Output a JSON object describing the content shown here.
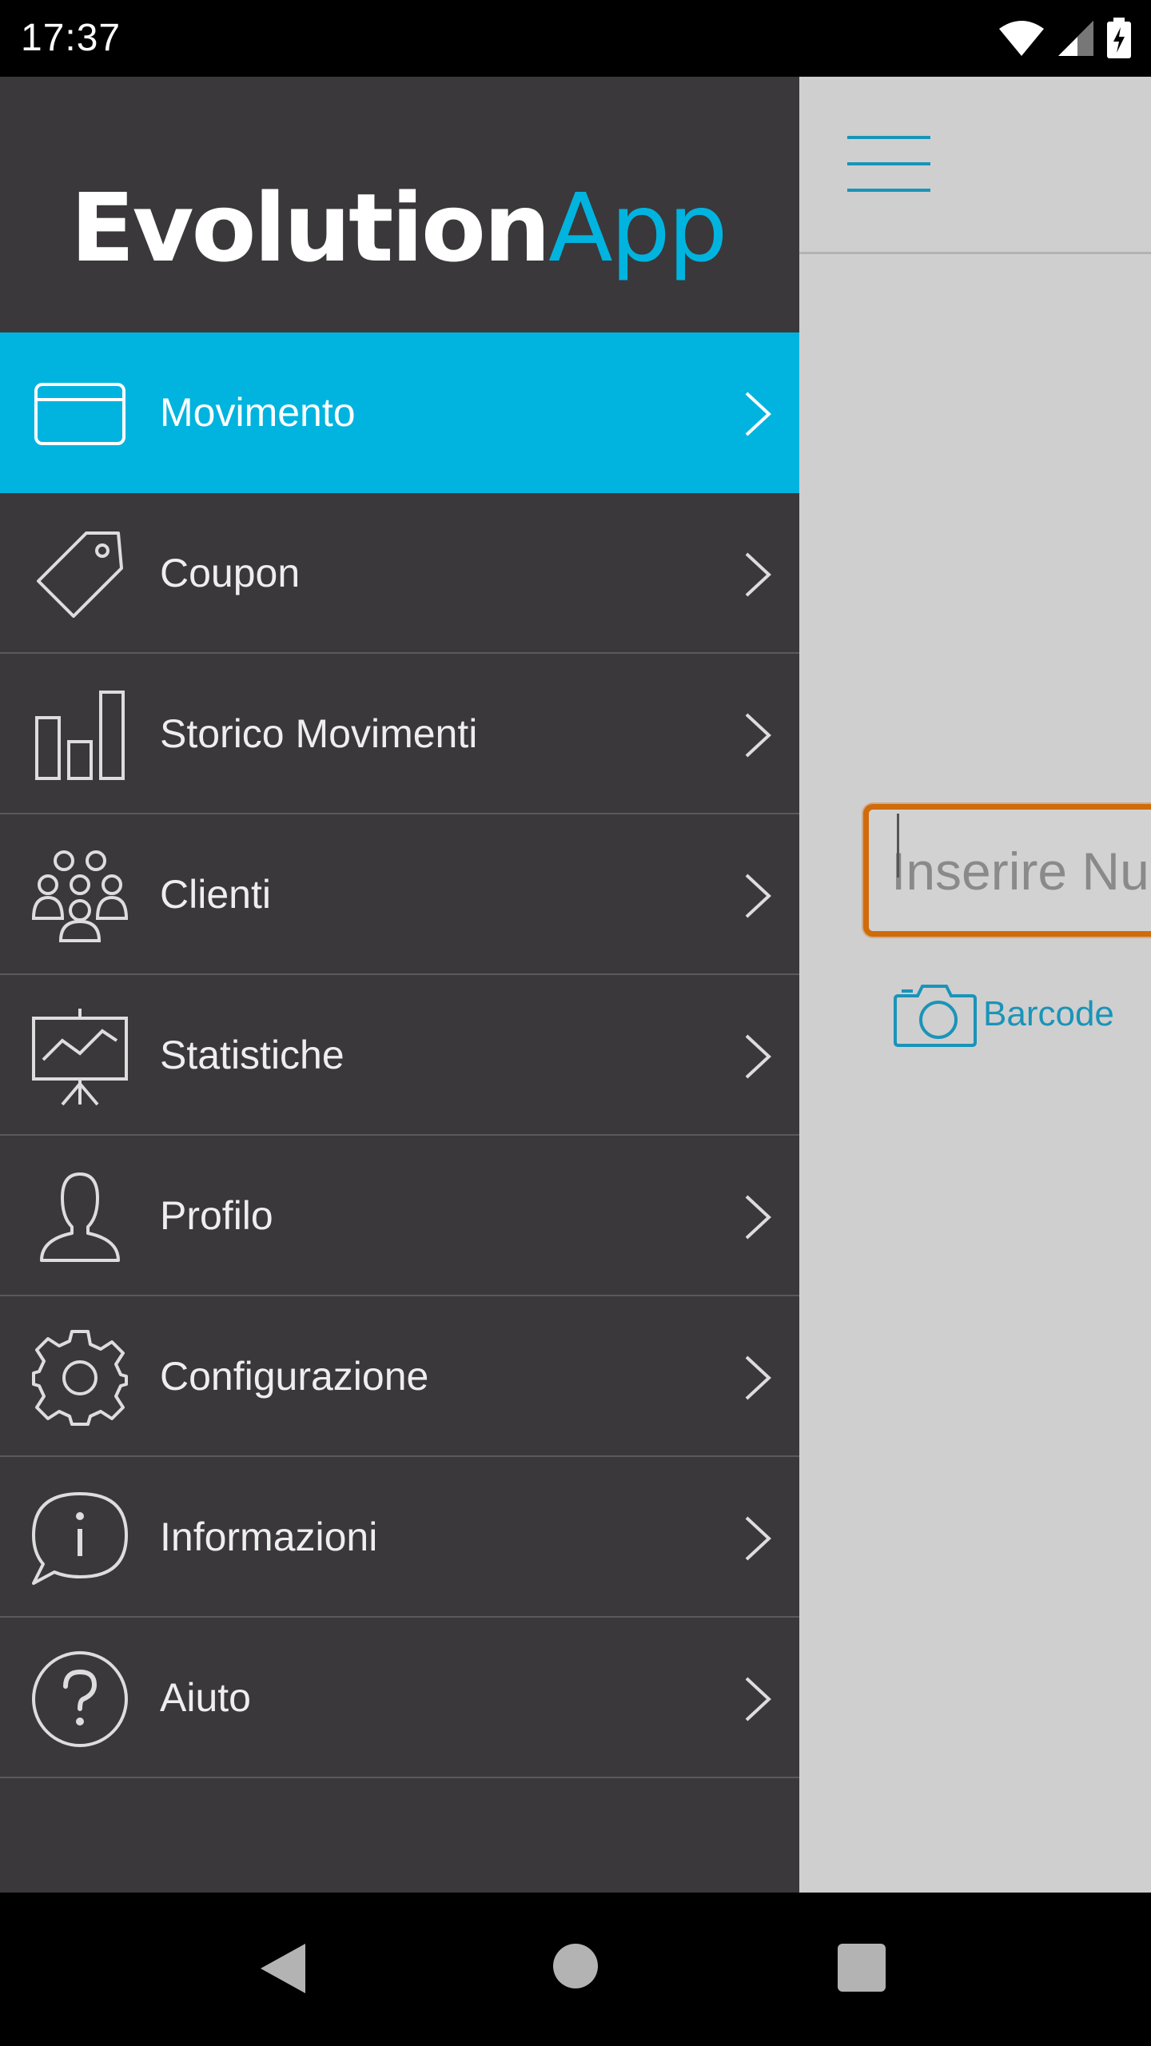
{
  "status_bar": {
    "time": "17:37",
    "icons": [
      "wifi-icon",
      "signal-icon",
      "battery-charging-icon"
    ]
  },
  "drawer": {
    "logo": {
      "part1": "Evolution",
      "part2": "App"
    },
    "accent_color": "#00b4df",
    "items": [
      {
        "label": "Movimento",
        "icon": "card-icon",
        "active": true
      },
      {
        "label": "Coupon",
        "icon": "tag-icon",
        "active": false
      },
      {
        "label": "Storico Movimenti",
        "icon": "bar-chart-icon",
        "active": false
      },
      {
        "label": "Clienti",
        "icon": "group-icon",
        "active": false
      },
      {
        "label": "Statistiche",
        "icon": "presentation-chart-icon",
        "active": false
      },
      {
        "label": "Profilo",
        "icon": "user-icon",
        "active": false
      },
      {
        "label": "Configurazione",
        "icon": "gear-icon",
        "active": false
      },
      {
        "label": "Informazioni",
        "icon": "info-bubble-icon",
        "active": false
      },
      {
        "label": "Aiuto",
        "icon": "help-icon",
        "active": false
      }
    ]
  },
  "main": {
    "search": {
      "placeholder": "Inserire Nu",
      "value": ""
    },
    "barcode_label": "Barcode",
    "highlight_color": "#d06b0b",
    "link_color": "#1a94b8"
  },
  "nav_bar": {
    "icons": [
      "back-icon",
      "home-icon",
      "recent-apps-icon"
    ]
  }
}
